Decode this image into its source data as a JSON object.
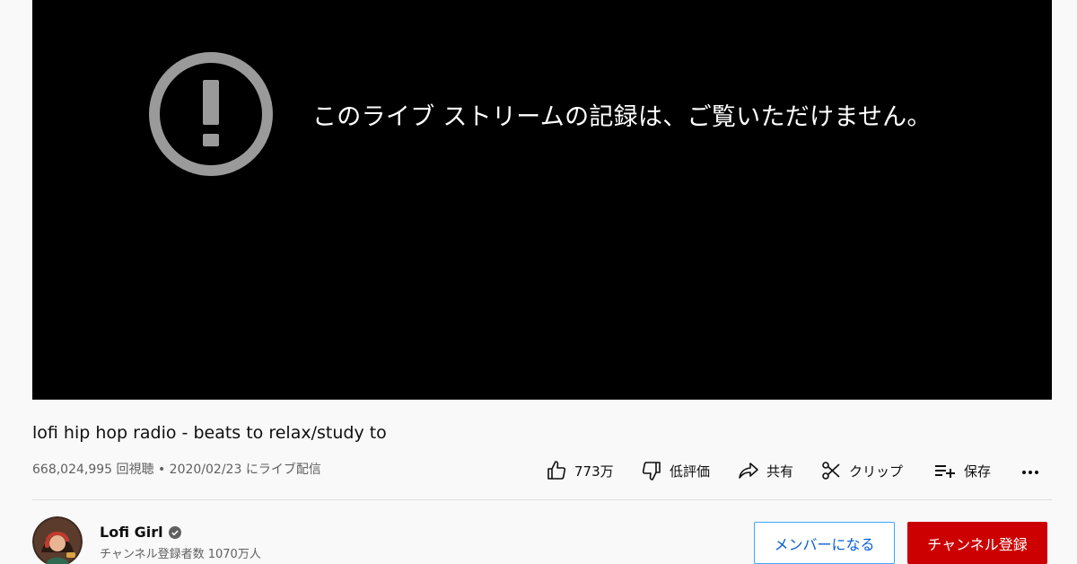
{
  "player": {
    "error_message": "このライブ ストリームの記録は、ご覧いただけません。",
    "error_icon": "alert-circle-icon"
  },
  "video": {
    "title": "lofi hip hop radio - beats to relax/study to",
    "meta": "668,024,995 回視聴 • 2020/02/23 にライブ配信"
  },
  "actions": {
    "like_count": "773万",
    "dislike_label": "低評価",
    "share_label": "共有",
    "clip_label": "クリップ",
    "save_label": "保存",
    "more_icon": "more-horizontal-icon"
  },
  "channel": {
    "name": "Lofi Girl",
    "subscribers": "チャンネル登録者数 1070万人",
    "verified_icon": "verified-check-icon"
  },
  "buttons": {
    "member_label": "メンバーになる",
    "subscribe_label": "チャンネル登録"
  },
  "colors": {
    "subscribe_bg": "#cc0000",
    "member_text": "#065fd4",
    "player_bg": "#000000"
  }
}
